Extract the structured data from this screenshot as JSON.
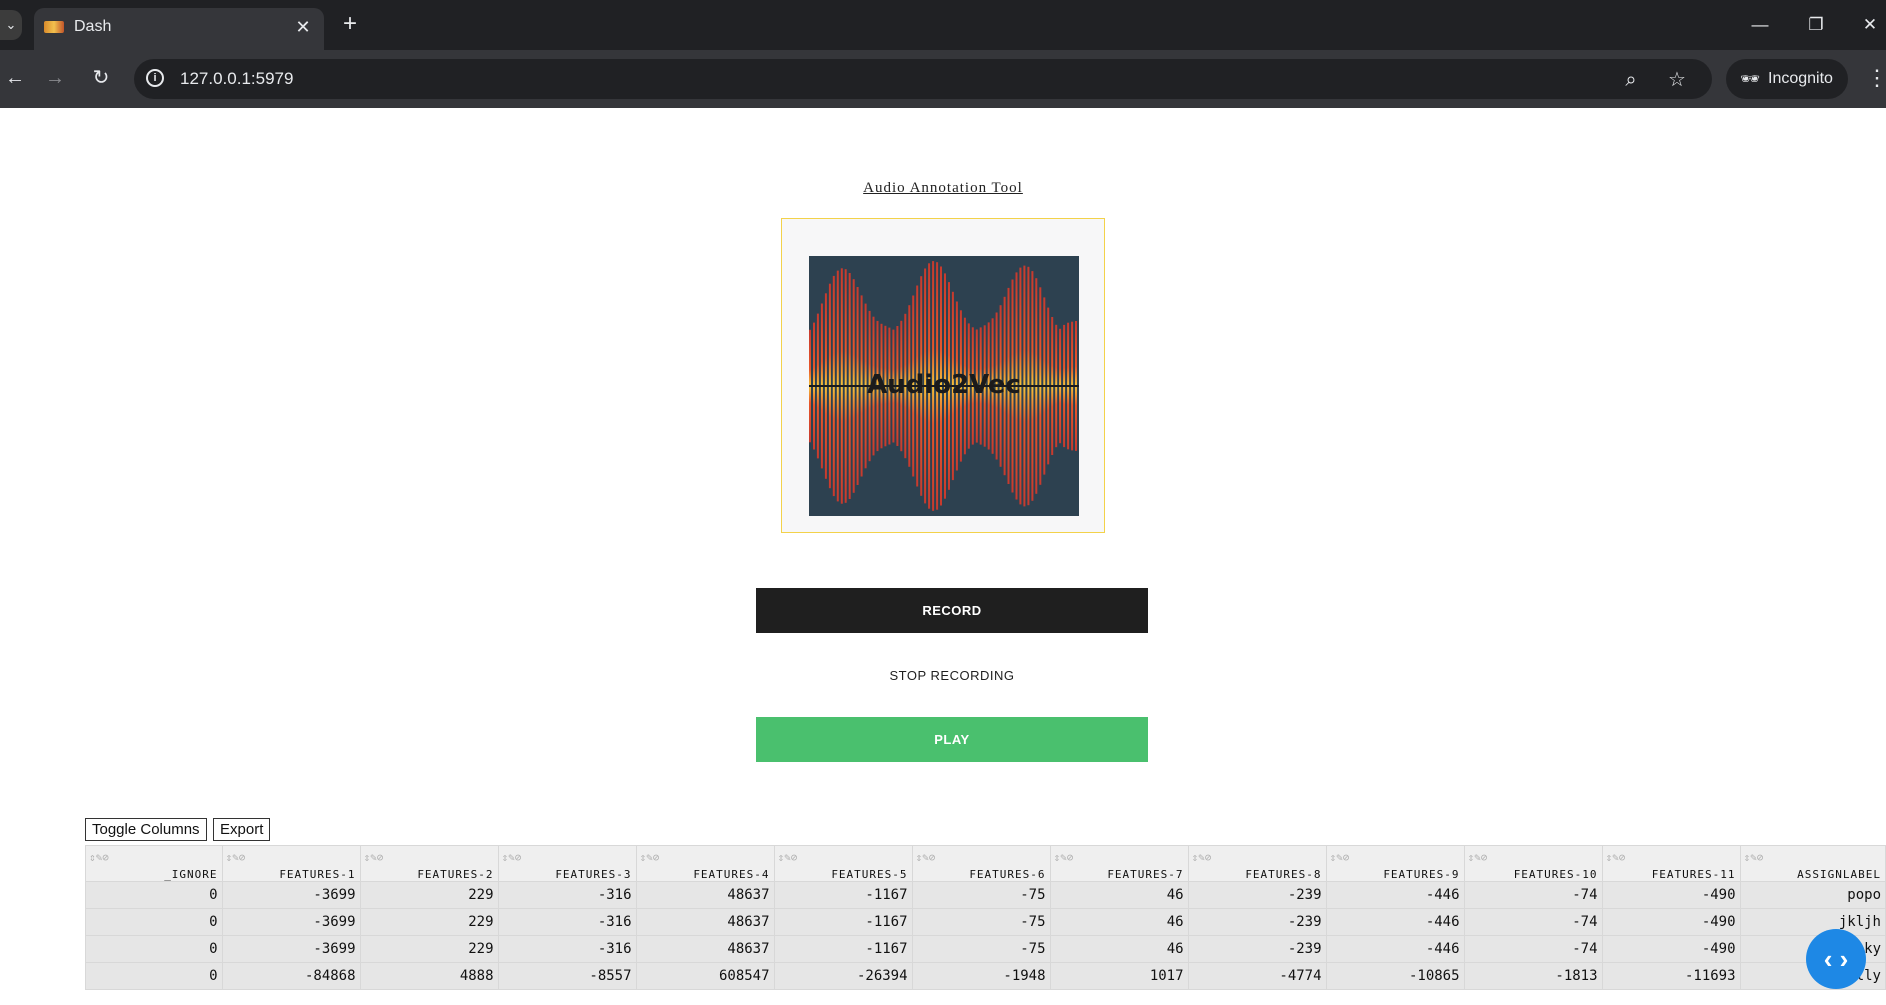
{
  "browser": {
    "tab_title": "Dash",
    "url": "127.0.0.1:5979",
    "incognito_label": "Incognito"
  },
  "page": {
    "title": "Audio Annotation Tool",
    "logo_text": "Audio2Vec",
    "buttons": {
      "record": "RECORD",
      "stop": "STOP RECORDING",
      "play": "PLAY"
    },
    "table_actions": {
      "toggle_columns": "Toggle Columns",
      "export": "Export"
    },
    "table": {
      "columns": [
        "_IGNORE",
        "FEATURES-1",
        "FEATURES-2",
        "FEATURES-3",
        "FEATURES-4",
        "FEATURES-5",
        "FEATURES-6",
        "FEATURES-7",
        "FEATURES-8",
        "FEATURES-9",
        "FEATURES-10",
        "FEATURES-11",
        "ASSIGNLABEL"
      ],
      "rows": [
        [
          "0",
          "-3699",
          "229",
          "-316",
          "48637",
          "-1167",
          "-75",
          "46",
          "-239",
          "-446",
          "-74",
          "-490",
          "popo"
        ],
        [
          "0",
          "-3699",
          "229",
          "-316",
          "48637",
          "-1167",
          "-75",
          "46",
          "-239",
          "-446",
          "-74",
          "-490",
          "jkljh"
        ],
        [
          "0",
          "-3699",
          "229",
          "-316",
          "48637",
          "-1167",
          "-75",
          "46",
          "-239",
          "-446",
          "-74",
          "-490",
          "jaky"
        ],
        [
          "0",
          "-84868",
          "4888",
          "-8557",
          "608547",
          "-26394",
          "-1948",
          "1017",
          "-4774",
          "-10865",
          "-1813",
          "-11693",
          "Dally"
        ]
      ]
    }
  },
  "colors": {
    "record_bg": "#1f1f1f",
    "play_bg": "#4ac06e",
    "logo_border": "#f3d24a",
    "fab_bg": "#1e88e5"
  }
}
